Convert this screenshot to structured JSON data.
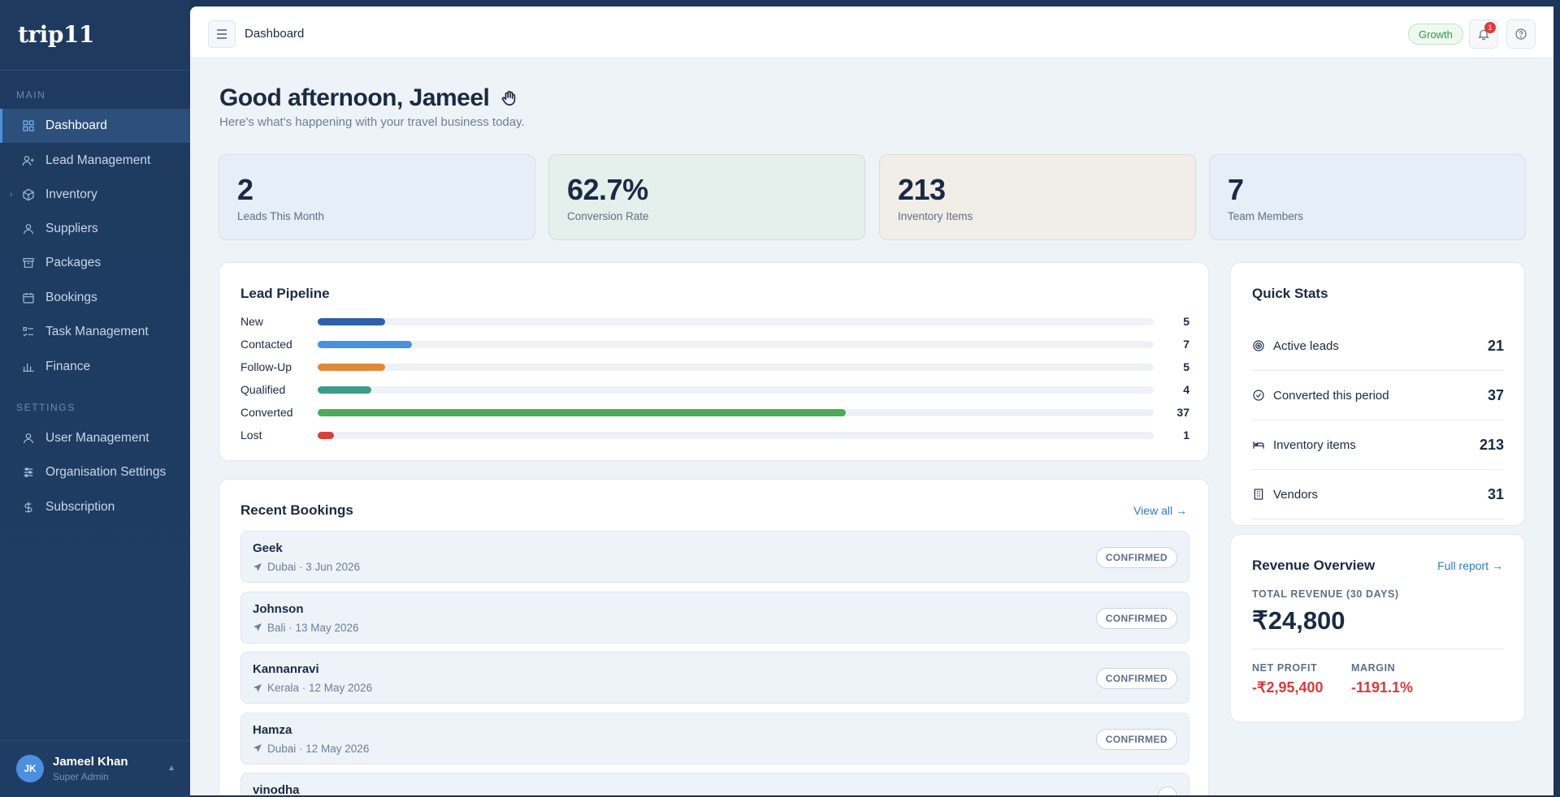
{
  "sidebar": {
    "logo": "trip11",
    "sections": {
      "main": "MAIN",
      "settings": "SETTINGS"
    },
    "items": [
      {
        "label": "Dashboard",
        "icon": "grid-icon"
      },
      {
        "label": "Lead Management",
        "icon": "user-plus-icon"
      },
      {
        "label": "Inventory",
        "icon": "box-icon"
      },
      {
        "label": "Suppliers",
        "icon": "user-icon"
      },
      {
        "label": "Packages",
        "icon": "archive-icon"
      },
      {
        "label": "Bookings",
        "icon": "calendar-icon"
      },
      {
        "label": "Task Management",
        "icon": "tasks-icon"
      },
      {
        "label": "Finance",
        "icon": "bar-chart-icon"
      }
    ],
    "settings_items": [
      {
        "label": "User Management",
        "icon": "user-icon"
      },
      {
        "label": "Organisation Settings",
        "icon": "sliders-icon"
      },
      {
        "label": "Subscription",
        "icon": "dollar-icon"
      }
    ],
    "user": {
      "initials": "JK",
      "name": "Jameel Khan",
      "role": "Super Admin"
    }
  },
  "topbar": {
    "title": "Dashboard",
    "plan": "Growth",
    "notifications": "1"
  },
  "greeting": {
    "title": "Good afternoon, Jameel",
    "subtitle": "Here's what's happening with your travel business today."
  },
  "kpis": [
    {
      "value": "2",
      "label": "Leads This Month"
    },
    {
      "value": "62.7%",
      "label": "Conversion Rate"
    },
    {
      "value": "213",
      "label": "Inventory Items"
    },
    {
      "value": "7",
      "label": "Team Members"
    }
  ],
  "pipeline": {
    "title": "Lead Pipeline",
    "stages": [
      {
        "label": "New",
        "value": 5,
        "color": "#2e5fa8"
      },
      {
        "label": "Contacted",
        "value": 7,
        "color": "#4a90e2"
      },
      {
        "label": "Follow-Up",
        "value": 5,
        "color": "#e0883a"
      },
      {
        "label": "Qualified",
        "value": 4,
        "color": "#3e9a86"
      },
      {
        "label": "Converted",
        "value": 37,
        "color": "#4caa5a"
      },
      {
        "label": "Lost",
        "value": 1,
        "color": "#d8403a"
      }
    ]
  },
  "bookings": {
    "title": "Recent Bookings",
    "view_all": "View all →",
    "items": [
      {
        "name": "Geek",
        "meta": "Dubai · 3 Jun 2026",
        "status": "CONFIRMED"
      },
      {
        "name": "Johnson",
        "meta": "Bali · 13 May 2026",
        "status": "CONFIRMED"
      },
      {
        "name": "Kannanravi",
        "meta": "Kerala · 12 May 2026",
        "status": "CONFIRMED"
      },
      {
        "name": "Hamza",
        "meta": "Dubai · 12 May 2026",
        "status": "CONFIRMED"
      },
      {
        "name": "vinodha",
        "meta": "",
        "status": ""
      }
    ]
  },
  "quick_stats": {
    "title": "Quick Stats",
    "items": [
      {
        "label": "Active leads",
        "value": "21",
        "icon": "target-icon"
      },
      {
        "label": "Converted this period",
        "value": "37",
        "icon": "check-circle-icon"
      },
      {
        "label": "Inventory items",
        "value": "213",
        "icon": "bed-icon"
      },
      {
        "label": "Vendors",
        "value": "31",
        "icon": "building-icon"
      }
    ]
  },
  "revenue": {
    "title": "Revenue Overview",
    "full_report": "Full report →",
    "total_label": "TOTAL REVENUE (30 DAYS)",
    "total": "₹24,800",
    "net_profit_label": "NET PROFIT",
    "net_profit": "-₹2,95,400",
    "margin_label": "MARGIN",
    "margin": "-1191.1%"
  }
}
